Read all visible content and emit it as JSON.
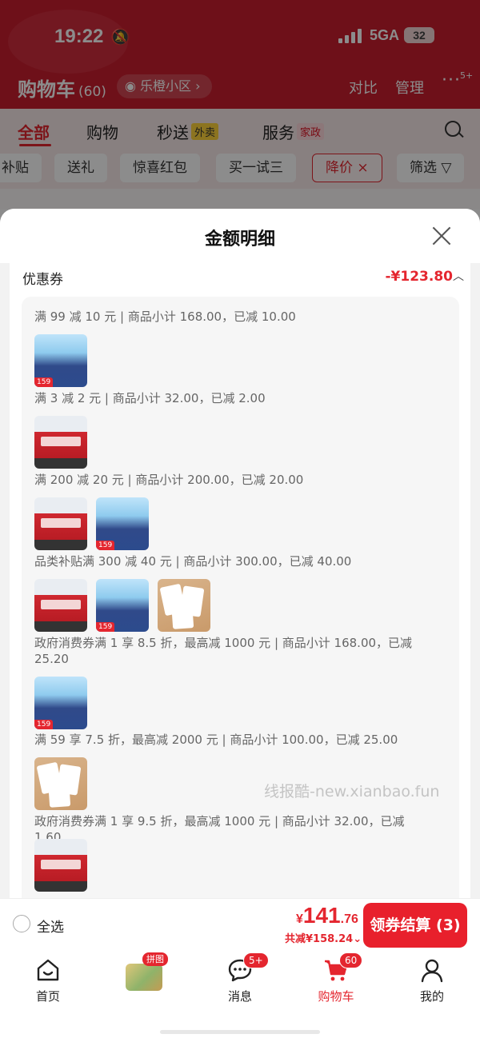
{
  "status_bar": {
    "time": "19:22",
    "network": "5GA",
    "battery": "32"
  },
  "cart_header": {
    "title": "购物车",
    "count": "(60)",
    "location": "乐橙小区",
    "compare": "对比",
    "manage": "管理",
    "more_badge": "5+"
  },
  "tabs": [
    {
      "label": "全部",
      "tag": ""
    },
    {
      "label": "购物",
      "tag": ""
    },
    {
      "label": "秒送",
      "tag": "外卖"
    },
    {
      "label": "服务",
      "tag": "家政"
    }
  ],
  "chips": [
    "补贴",
    "送礼",
    "惊喜红包",
    "买一试三",
    "降价",
    "筛选"
  ],
  "sheet": {
    "title": "金额明细",
    "section_label": "优惠券",
    "section_amount": "-¥123.80",
    "coupons": [
      {
        "text": "满 99 减 10 元 | 商品小计 168.00，已减 10.00",
        "items": [
          "puzzle"
        ]
      },
      {
        "text": "满 3 减 2 元 | 商品小计 32.00，已减 2.00",
        "items": [
          "bus"
        ]
      },
      {
        "text": "满 200 减 20 元 | 商品小计 200.00，已减 20.00",
        "items": [
          "bus",
          "puzzle"
        ]
      },
      {
        "text": "品类补贴满 300 减 40 元 | 商品小计 300.00，已减 40.00",
        "items": [
          "bus",
          "puzzle",
          "cards"
        ]
      },
      {
        "text": "政府消费券满 1 享 8.5 折，最高减 1000 元 | 商品小计 168.00，已减 25.20",
        "items": [
          "puzzle"
        ]
      },
      {
        "text": "满 59 享 7.5 折，最高减 2000 元 | 商品小计 100.00，已减 25.00",
        "items": [
          "cards"
        ]
      },
      {
        "text": "政府消费券满 1 享 9.5 折，最高减 1000 元 | 商品小计 32.00，已减 1.60",
        "items": [
          "bus"
        ]
      }
    ],
    "thumb_tag": "159",
    "watermark": "线报酷-new.xianbao.fun"
  },
  "checkout": {
    "select_all": "全选",
    "currency": "¥",
    "price_int": "141",
    "price_dec": ".76",
    "saved": "共减¥158.24",
    "pay_button": "领券结算 (3)"
  },
  "nav": [
    {
      "label": "首页",
      "icon": "home-icon",
      "badge": ""
    },
    {
      "label": "",
      "icon": "promo-image",
      "badge": "拼图"
    },
    {
      "label": "消息",
      "icon": "message-icon",
      "badge": "5+"
    },
    {
      "label": "购物车",
      "icon": "cart-icon",
      "badge": "60"
    },
    {
      "label": "我的",
      "icon": "profile-icon",
      "badge": ""
    }
  ],
  "colors": {
    "brand_red": "#e4262f",
    "header_red": "#c81e2e"
  }
}
